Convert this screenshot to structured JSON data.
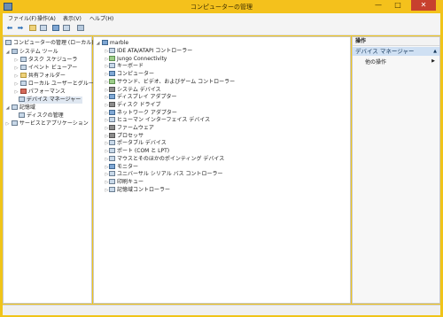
{
  "window": {
    "title": "コンピューターの管理",
    "minimize": "—",
    "maximize": "□",
    "close": "✕"
  },
  "menu": [
    "ファイル(F)",
    "操作(A)",
    "表示(V)",
    "ヘルプ(H)"
  ],
  "left_tree": [
    {
      "label": "コンピューターの管理 (ローカル)",
      "level": 0,
      "expander": "",
      "icon": "computer-management-icon"
    },
    {
      "label": "システム ツール",
      "level": 1,
      "expander": "◢",
      "icon": "tools-icon"
    },
    {
      "label": "タスク スケジューラ",
      "level": 2,
      "expander": "▷",
      "icon": "task-scheduler-icon"
    },
    {
      "label": "イベント ビューアー",
      "level": 2,
      "expander": "▷",
      "icon": "event-viewer-icon"
    },
    {
      "label": "共有フォルダー",
      "level": 2,
      "expander": "▷",
      "icon": "shared-folders-icon"
    },
    {
      "label": "ローカル ユーザーとグループ",
      "level": 2,
      "expander": "▷",
      "icon": "local-users-icon"
    },
    {
      "label": "パフォーマンス",
      "level": 2,
      "expander": "▷",
      "icon": "performance-icon"
    },
    {
      "label": "デバイス マネージャー",
      "level": 2,
      "expander": "",
      "icon": "device-manager-icon",
      "selected": true
    },
    {
      "label": "記憶域",
      "level": 1,
      "expander": "◢",
      "icon": "storage-icon"
    },
    {
      "label": "ディスクの管理",
      "level": 2,
      "expander": "",
      "icon": "disk-management-icon"
    },
    {
      "label": "サービスとアプリケーション",
      "level": 1,
      "expander": "▷",
      "icon": "services-icon"
    }
  ],
  "device_tree": {
    "root": "marble",
    "root_expander": "◢",
    "items": [
      {
        "label": "IDE ATA/ATAPI コントローラー",
        "icon": "ide-controller-icon"
      },
      {
        "label": "Jungo Connectivity",
        "icon": "jungo-icon"
      },
      {
        "label": "キーボード",
        "icon": "keyboard-icon"
      },
      {
        "label": "コンピューター",
        "icon": "computer-icon"
      },
      {
        "label": "サウンド、ビデオ、およびゲーム コントローラー",
        "icon": "sound-icon"
      },
      {
        "label": "システム デバイス",
        "icon": "system-devices-icon"
      },
      {
        "label": "ディスプレイ アダプター",
        "icon": "display-adapter-icon"
      },
      {
        "label": "ディスク ドライブ",
        "icon": "disk-drive-icon"
      },
      {
        "label": "ネットワーク アダプター",
        "icon": "network-adapter-icon"
      },
      {
        "label": "ヒューマン インターフェイス デバイス",
        "icon": "hid-icon"
      },
      {
        "label": "ファームウェア",
        "icon": "firmware-icon"
      },
      {
        "label": "プロセッサ",
        "icon": "processor-icon"
      },
      {
        "label": "ポータブル デバイス",
        "icon": "portable-device-icon"
      },
      {
        "label": "ポート (COM と LPT)",
        "icon": "ports-icon"
      },
      {
        "label": "マウスとそのほかのポインティング デバイス",
        "icon": "mouse-icon"
      },
      {
        "label": "モニター",
        "icon": "monitor-icon"
      },
      {
        "label": "ユニバーサル シリアル バス コントローラー",
        "icon": "usb-icon"
      },
      {
        "label": "印刷キュー",
        "icon": "print-queue-icon"
      },
      {
        "label": "記憶域コントローラー",
        "icon": "storage-controller-icon"
      }
    ],
    "item_expander": "▷"
  },
  "actions": {
    "header": "操作",
    "section": "デバイス マネージャー",
    "section_arrow": "▲",
    "item": "他の操作",
    "item_arrow": "▶"
  }
}
